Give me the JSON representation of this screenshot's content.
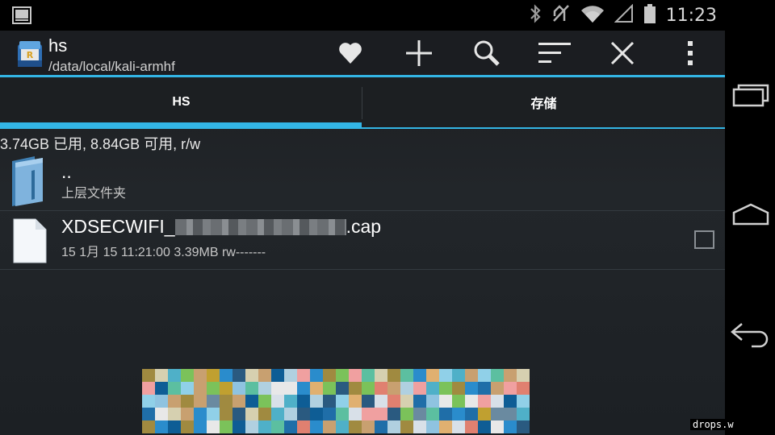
{
  "status_bar": {
    "time": "11:23",
    "left_icon": "terminal-notification-icon",
    "right_icons": [
      "bluetooth-icon",
      "muted-icon",
      "wifi-icon",
      "cell-signal-icon",
      "battery-icon"
    ]
  },
  "action_bar": {
    "title": "hs",
    "subtitle": "/data/local/kali-armhf",
    "actions": [
      "favorite-icon",
      "add-icon",
      "search-icon",
      "sort-icon",
      "close-icon",
      "overflow-menu-icon"
    ]
  },
  "tabs": [
    {
      "label": "HS",
      "selected": true
    },
    {
      "label": "存储",
      "selected": false
    }
  ],
  "storage_info": "3.74GB 已用, 8.84GB 可用, r/w",
  "files": [
    {
      "name": "..",
      "meta": "上层文件夹",
      "icon": "folder-icon"
    },
    {
      "name_prefix": "XDSECWIFI_",
      "name_suffix": ".cap",
      "meta": "15 1月 15 11:21:00  3.39MB  rw-------",
      "icon": "file-icon",
      "checked": false
    }
  ],
  "navigation": [
    "recent-apps-icon",
    "home-icon",
    "back-icon"
  ],
  "watermark": "drops.w",
  "colors": {
    "accent": "#33b5e5",
    "background": "#1e2226"
  }
}
